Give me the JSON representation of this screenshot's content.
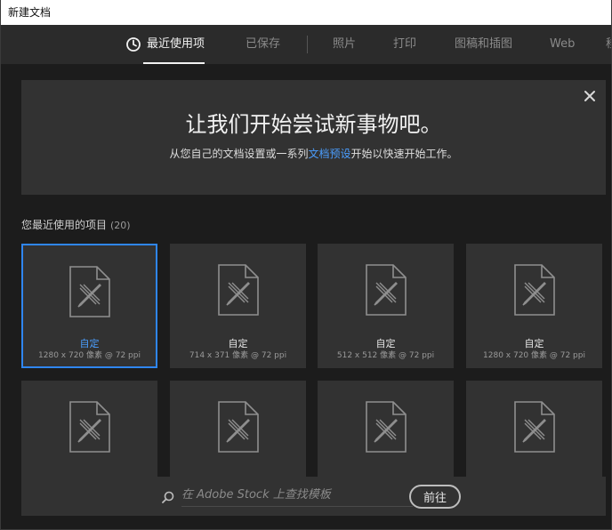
{
  "window": {
    "title": "新建文档"
  },
  "tabs": [
    {
      "label": "最近使用项",
      "active": true
    },
    {
      "label": "已保存"
    },
    {
      "label": "照片"
    },
    {
      "label": "打印"
    },
    {
      "label": "图稿和插图"
    },
    {
      "label": "Web"
    },
    {
      "label": "移"
    }
  ],
  "banner": {
    "title": "让我们开始尝试新事物吧。",
    "subtitle_pre": "从您自己的文档设置或一系列",
    "subtitle_link": "文档预设",
    "subtitle_post": "开始以快速开始工作。"
  },
  "recent": {
    "heading": "您最近使用的项目",
    "count": "(20)",
    "items": [
      {
        "name": "自定",
        "meta": "1280 x 720 像素 @ 72 ppi",
        "selected": true
      },
      {
        "name": "自定",
        "meta": "714 x 371 像素 @ 72 ppi"
      },
      {
        "name": "自定",
        "meta": "512 x 512 像素 @ 72 ppi"
      },
      {
        "name": "自定",
        "meta": "1280 x 720 像素 @ 72 ppi"
      },
      {
        "name": "",
        "meta": ""
      },
      {
        "name": "",
        "meta": ""
      },
      {
        "name": "",
        "meta": ""
      },
      {
        "name": "",
        "meta": ""
      }
    ]
  },
  "search": {
    "placeholder": "在 Adobe Stock 上查找模板",
    "button_label": "前往"
  },
  "colors": {
    "accent": "#2f86f0",
    "link": "#4b9eff",
    "background": "#1c1c1c",
    "panel": "#323232"
  },
  "icons": {
    "recent_tab": "clock-icon",
    "close": "close-icon",
    "document": "document-pencil-ruler-icon",
    "search": "search-icon"
  }
}
